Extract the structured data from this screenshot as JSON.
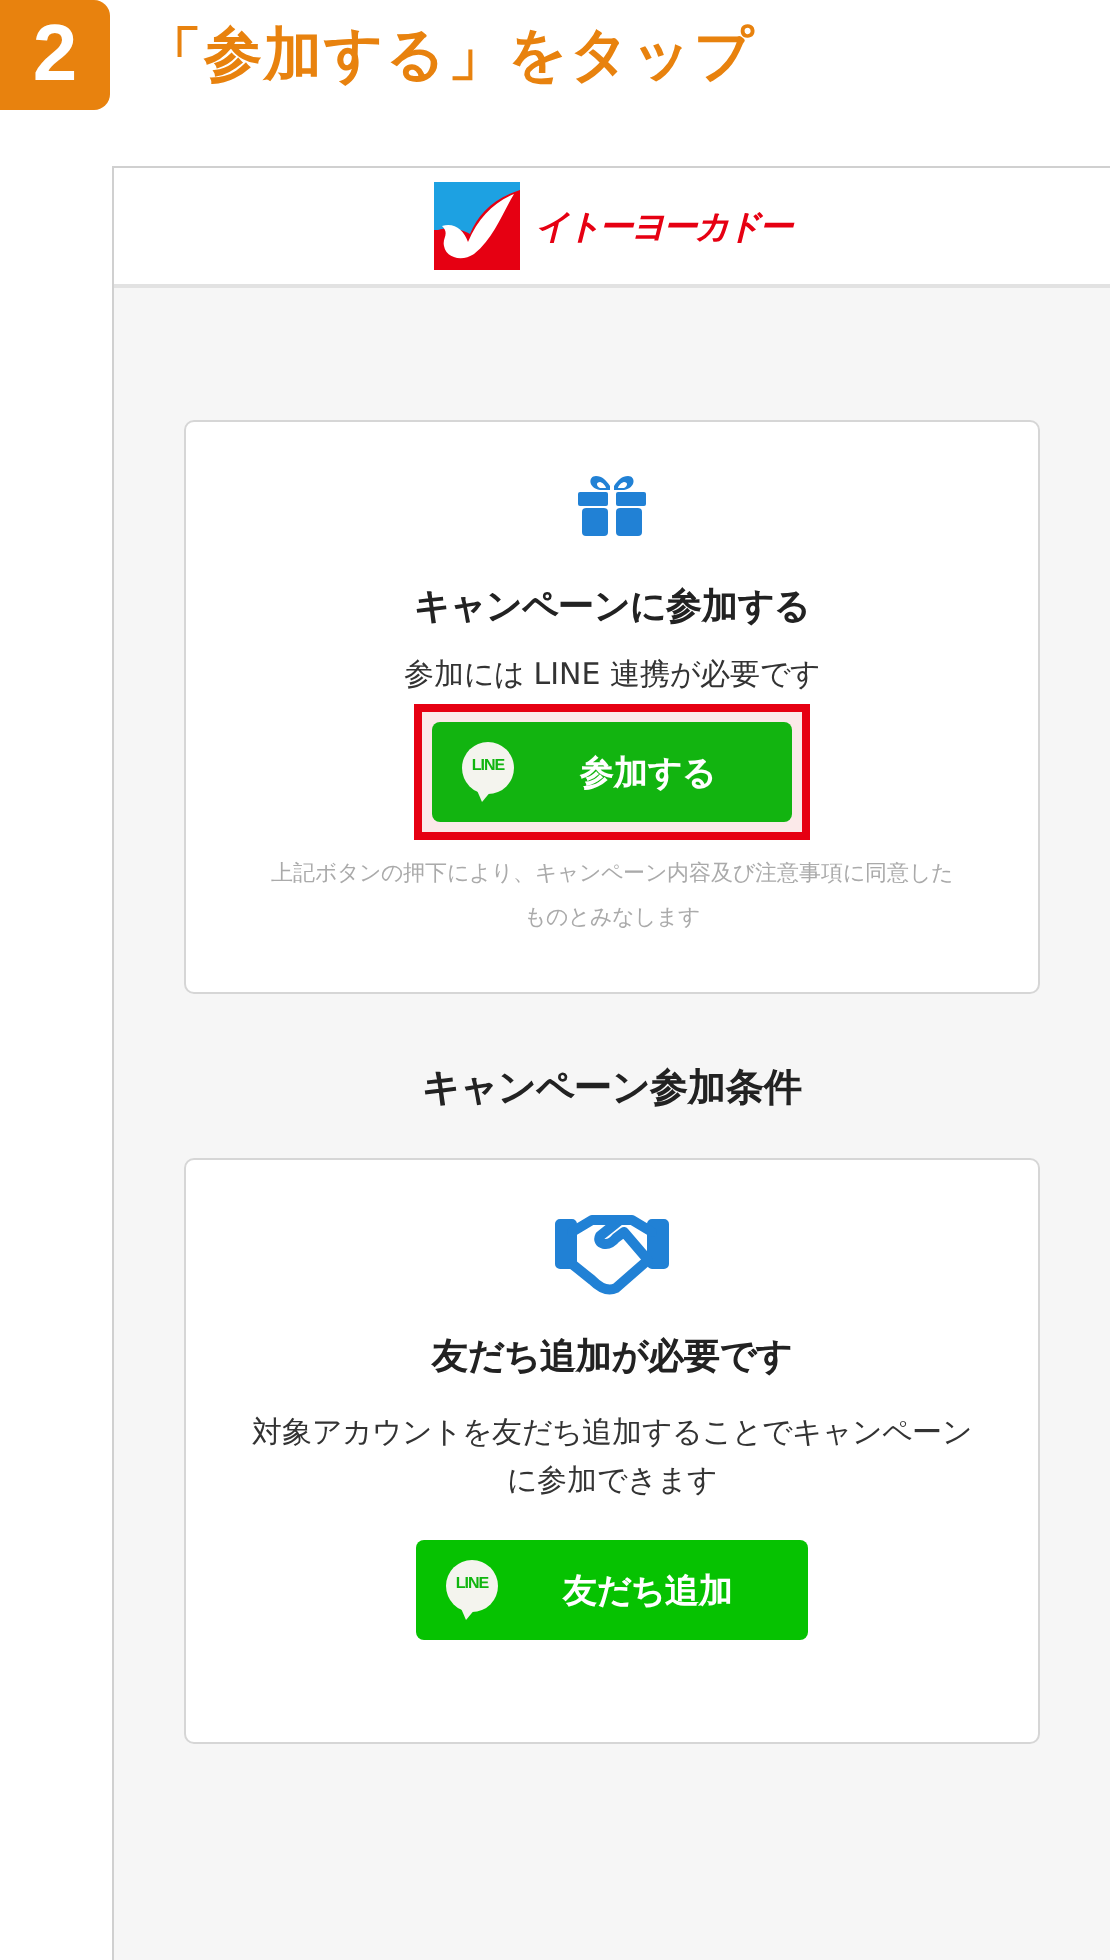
{
  "step": {
    "number": "2",
    "title": "「参加する」をタップ"
  },
  "header": {
    "logo_text": "イトーヨーカドー"
  },
  "cards": [
    {
      "kind": "gift",
      "title": "キャンペーンに参加する",
      "text": "参加には LINE 連携が必要です",
      "button": {
        "label": "参加する",
        "logo_text": "LINE",
        "highlighted": true
      },
      "note": "上記ボタンの押下により、キャンペーン内容及び注意事項に同意したものとみなします"
    },
    {
      "kind": "handshake",
      "heading": "キャンペーン参加条件",
      "title": "友だち追加が必要です",
      "text": "対象アカウントを友だち追加することでキャンペーンに参加できます",
      "button": {
        "label": "友だち追加",
        "logo_text": "LINE",
        "highlighted": false
      }
    }
  ]
}
